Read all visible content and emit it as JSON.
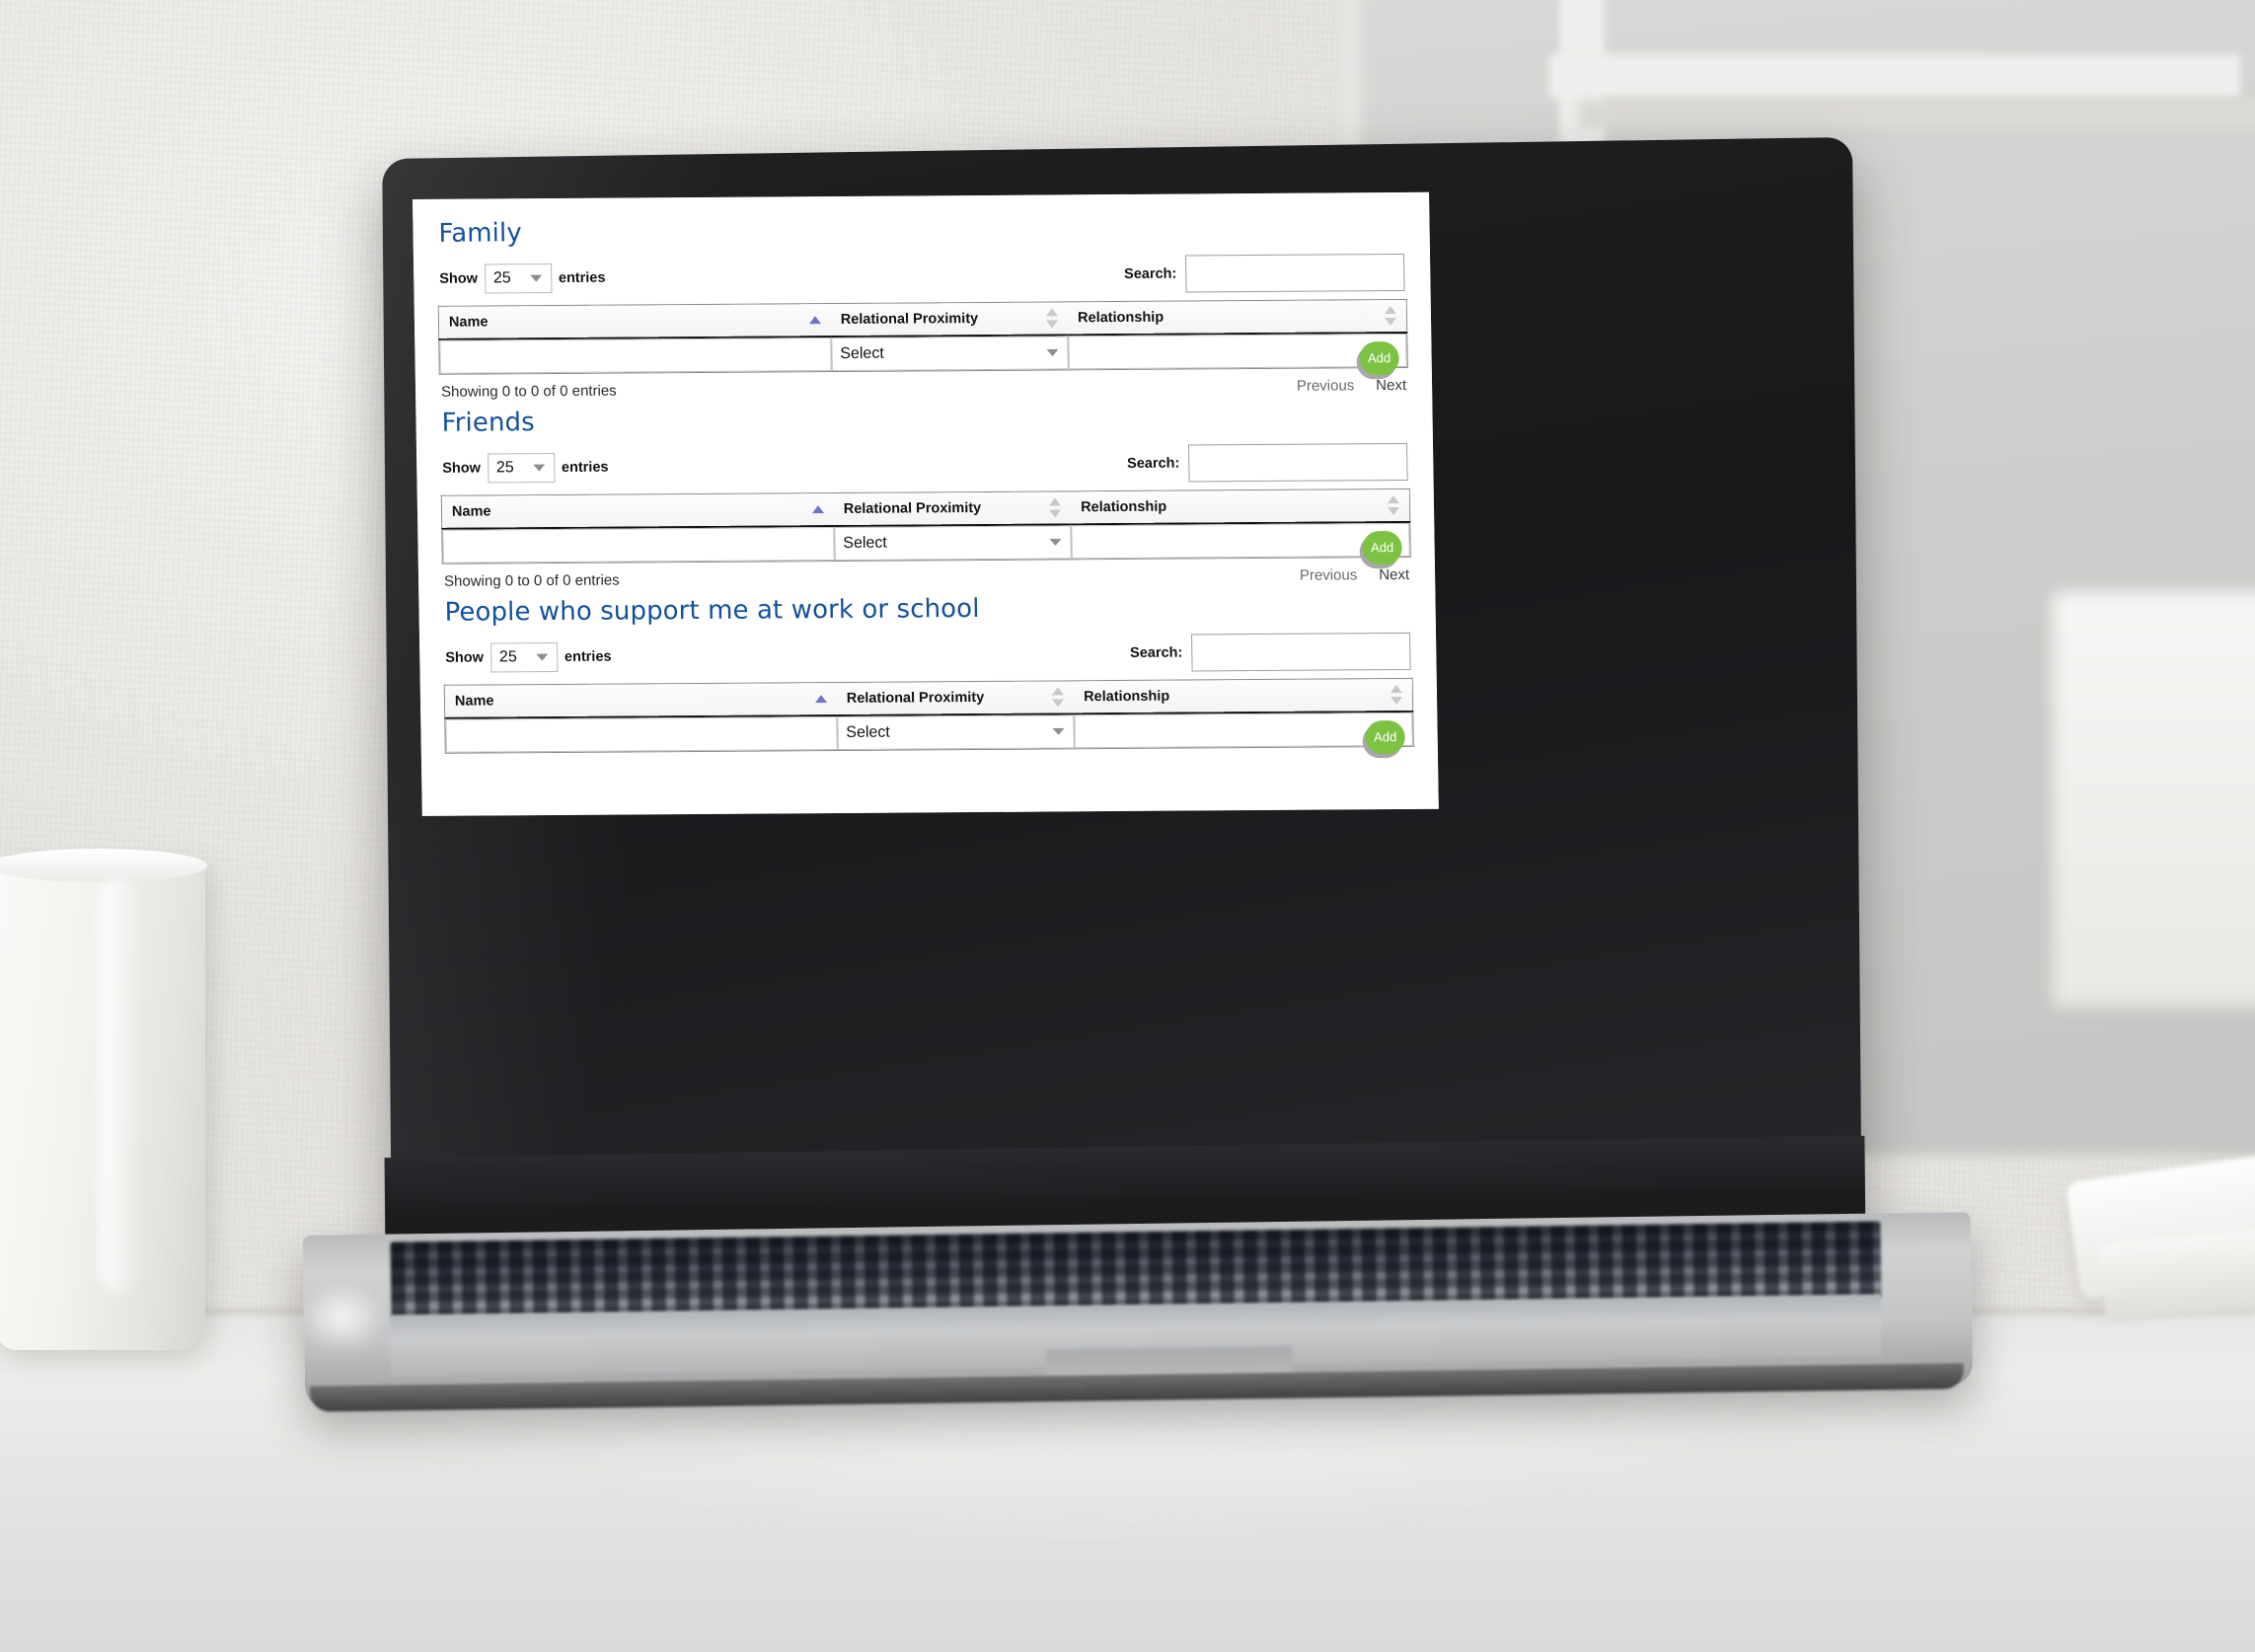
{
  "scene": {
    "device": "laptop",
    "surface": "white-desk",
    "objects": [
      "white-mug",
      "papers"
    ]
  },
  "theme": {
    "heading_color": "#14519b",
    "add_button_color": "#7dc243",
    "add_button_shadow": "#a8a8a8",
    "sort_active_color": "#6f74c9",
    "sort_idle_color": "#c9c9c9",
    "name_cell_bg": "#bdbdbd",
    "other_cell_bg": "#e3e3e3"
  },
  "common": {
    "show_label": "Show",
    "entries_label": "entries",
    "entries_value": "25",
    "search_label": "Search:",
    "search_value": "",
    "search_placeholder": "",
    "columns": {
      "name": "Name",
      "proximity": "Relational Proximity",
      "relationship": "Relationship"
    },
    "row": {
      "name_value": "",
      "name_placeholder": "",
      "proximity_value": "Select",
      "relationship_value": "",
      "relationship_placeholder": "",
      "add_label": "Add"
    },
    "info": "Showing 0 to 0 of 0 entries",
    "paging": {
      "previous": "Previous",
      "next": "Next"
    }
  },
  "sections": [
    {
      "id": "family",
      "title": "Family",
      "entries_value": "25",
      "search_value": "",
      "info": "Showing 0 to 0 of 0 entries",
      "has_footer": true
    },
    {
      "id": "friends",
      "title": "Friends",
      "entries_value": "25",
      "search_value": "",
      "info": "Showing 0 to 0 of 0 entries",
      "has_footer": true
    },
    {
      "id": "work-school",
      "title": "People who support me at work or school",
      "entries_value": "25",
      "search_value": "",
      "info": "Showing 0 to 0 of 0 entries",
      "has_footer": false
    }
  ]
}
